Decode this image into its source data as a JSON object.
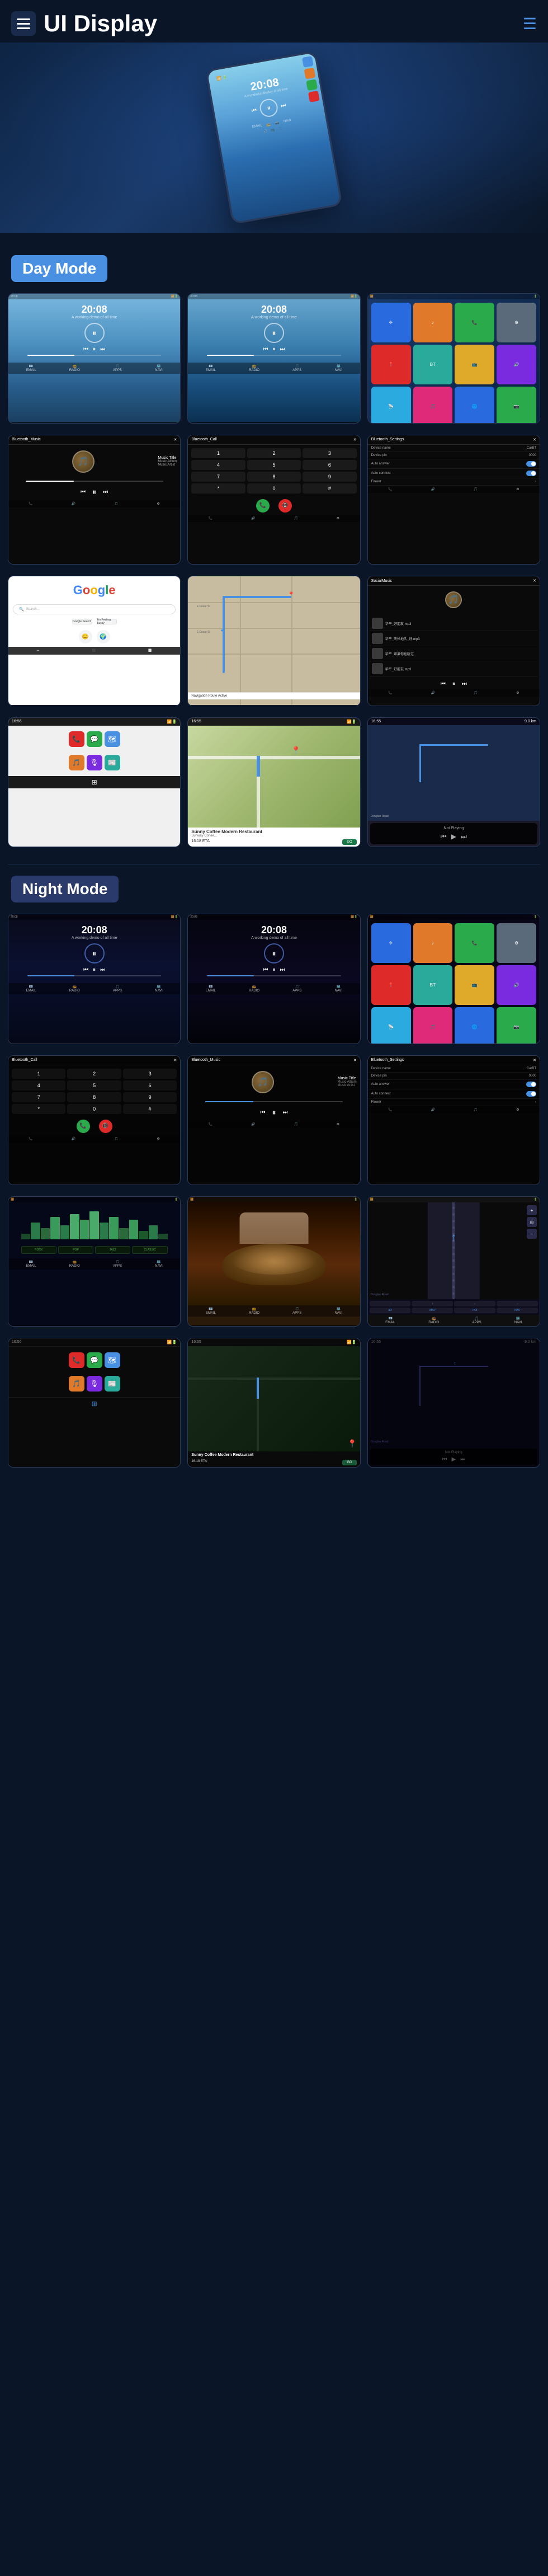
{
  "header": {
    "title": "UI Display",
    "menu_label": "menu",
    "nav_label": "navigation"
  },
  "sections": {
    "day_mode": "Day Mode",
    "night_mode": "Night Mode"
  },
  "screens": {
    "time": "20:08",
    "music_title": "Music Title",
    "music_album": "Music Album",
    "music_artist": "Music Artist",
    "bluetooth_music": "Bluetooth_Music",
    "bluetooth_call": "Bluetooth_Call",
    "bluetooth_settings": "Bluetooth_Settings",
    "device_name": "Device name",
    "device_name_val": "CarBT",
    "device_pin": "Device pin",
    "device_pin_val": "0000",
    "auto_answer": "Auto answer",
    "auto_connect": "Auto connect",
    "flower": "Flower",
    "restaurant_name": "Sunny Coffee Modern Restaurant",
    "restaurant_detail": "Sunway Coffee...",
    "go_btn": "GO",
    "not_playing": "Not Playing",
    "google_text": "Google",
    "nav_road": "Donglue Road",
    "nav_eta": "16 ETA",
    "nav_distance": "9.0 km",
    "song1": "华平_好朋友.mp3",
    "song2": "华平_天长地久_好.mp3",
    "song3": "华平_如果你也听过",
    "song4": "华平_好朋友.mp3"
  },
  "colors": {
    "accent": "#4a90e2",
    "background": "#0a1628",
    "day_badge": "#4a90e2",
    "night_badge": "#2a3a6a"
  }
}
